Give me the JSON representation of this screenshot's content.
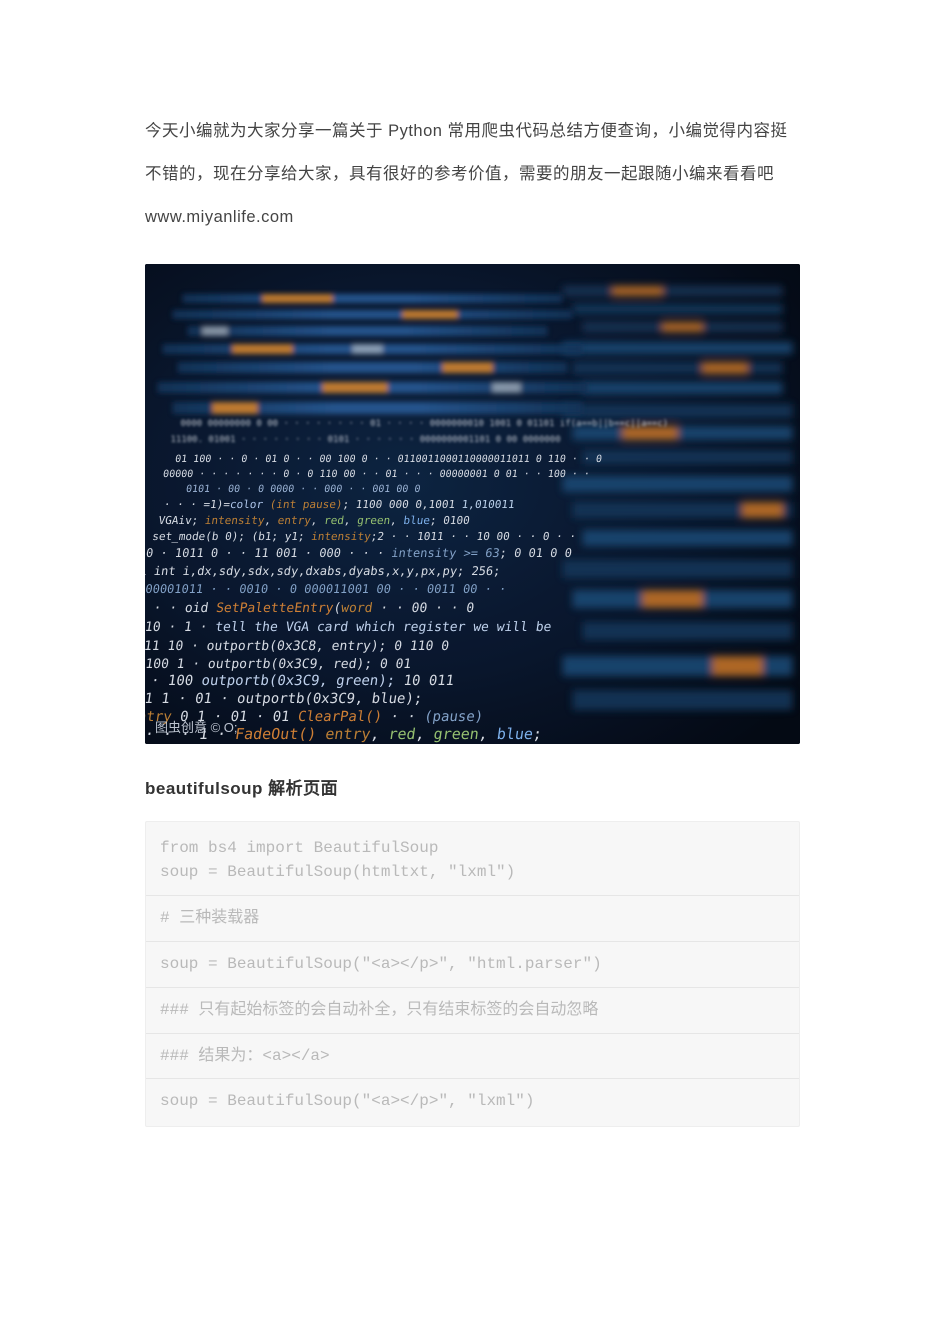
{
  "intro": "今天小编就为大家分享一篇关于 Python 常用爬虫代码总结方便查询，小编觉得内容挺不错的，现在分享给大家，具有很好的参考价值，需要的朋友一起跟随小编来看看吧 www.miyanlife.com",
  "image_watermark": "图虫创意 © O;",
  "section_title": "beautifulsoup 解析页面",
  "code_lines": [
    "from bs4 import BeautifulSoup",
    "soup = BeautifulSoup(htmltxt, \"lxml\")",
    "",
    "# 三种装载器",
    "",
    "soup = BeautifulSoup(\"<a></p>\", \"html.parser\")",
    "",
    "### 只有起始标签的会自动补全，只有结束标签的会自动忽略",
    "",
    "### 结果为：<a></a>",
    "",
    "soup = BeautifulSoup(\"<a></p>\", \"lxml\")"
  ]
}
